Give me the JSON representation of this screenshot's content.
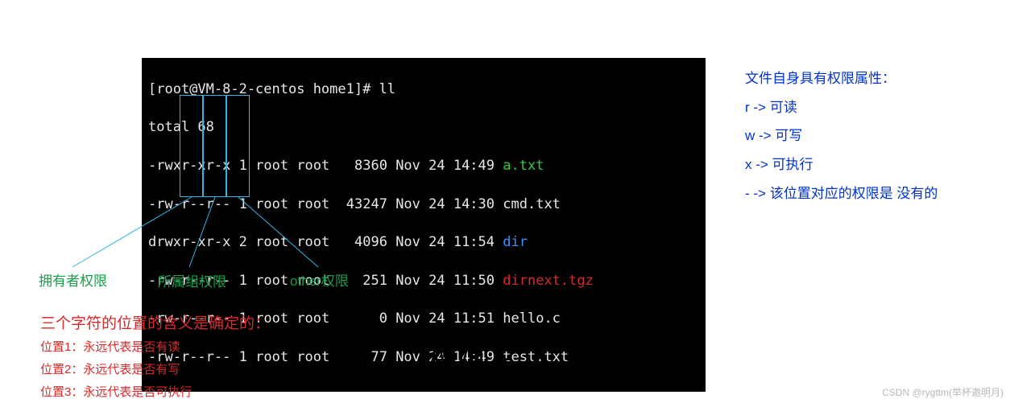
{
  "terminal": {
    "prompt": "[root@VM-8-2-centos home1]# ll",
    "total": "total 68",
    "rows": [
      {
        "perm": "-rwxr-xr-x",
        "ln": "1",
        "owner": "root",
        "group": "root",
        "size": "  8360",
        "date": "Nov 24 14:49",
        "name": "a.txt",
        "cls": "tg"
      },
      {
        "perm": "-rw-r--r--",
        "ln": "1",
        "owner": "root",
        "group": "root",
        "size": " 43247",
        "date": "Nov 24 14:30",
        "name": "cmd.txt",
        "cls": ""
      },
      {
        "perm": "drwxr-xr-x",
        "ln": "2",
        "owner": "root",
        "group": "root",
        "size": "  4096",
        "date": "Nov 24 11:54",
        "name": "dir",
        "cls": "tb"
      },
      {
        "perm": "-rw-r--r--",
        "ln": "1",
        "owner": "root",
        "group": "root",
        "size": "   251",
        "date": "Nov 24 11:50",
        "name": "dirnext.tgz",
        "cls": "tr"
      },
      {
        "perm": "-rw-r--r--",
        "ln": "1",
        "owner": "root",
        "group": "root",
        "size": "     0",
        "date": "Nov 24 11:51",
        "name": "hello.c",
        "cls": ""
      },
      {
        "perm": "-rw-r--r--",
        "ln": "1",
        "owner": "root",
        "group": "root",
        "size": "    77",
        "date": "Nov 24 14:49",
        "name": "test.txt",
        "cls": ""
      }
    ]
  },
  "labels": {
    "owner": "拥有者权限",
    "group": "所属组权限",
    "other": "other权限"
  },
  "right": {
    "title": "文件自身具有权限属性：",
    "r": "r  ->   可读",
    "w": "w ->   可写",
    "x": "x  ->   可执行",
    "dash": "-  ->   该位置对应的权限是 没有的"
  },
  "meaning": {
    "title": "三个字符的位置的含义是确定的：",
    "p1": "位置1：永远代表是否有读",
    "p2": "位置2：永远代表是否有写",
    "p3": "位置3：永远代表是否可执行"
  },
  "formula": "权限 = 人 + 文件属性",
  "watermark": "CSDN @rygttm(举杯邀明月)"
}
